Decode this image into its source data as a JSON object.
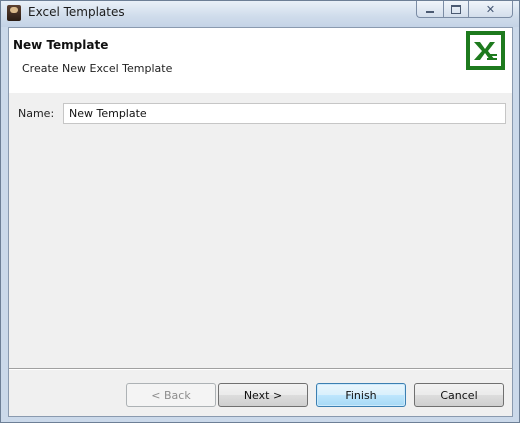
{
  "window": {
    "title": "Excel Templates",
    "controls": {
      "minimize_icon": "minimize-icon",
      "maximize_icon": "maximize-icon",
      "close_icon": "close-icon",
      "close_glyph": "✕"
    }
  },
  "banner": {
    "title": "New Template",
    "description": "Create New Excel Template",
    "logo_icon": "excel-logo-icon",
    "logo_color": "#1d7a1d"
  },
  "form": {
    "name_label": "Name:",
    "name_value": "New Template"
  },
  "buttons": {
    "back_label": "< Back",
    "next_label": "Next >",
    "finish_label": "Finish",
    "cancel_label": "Cancel"
  }
}
